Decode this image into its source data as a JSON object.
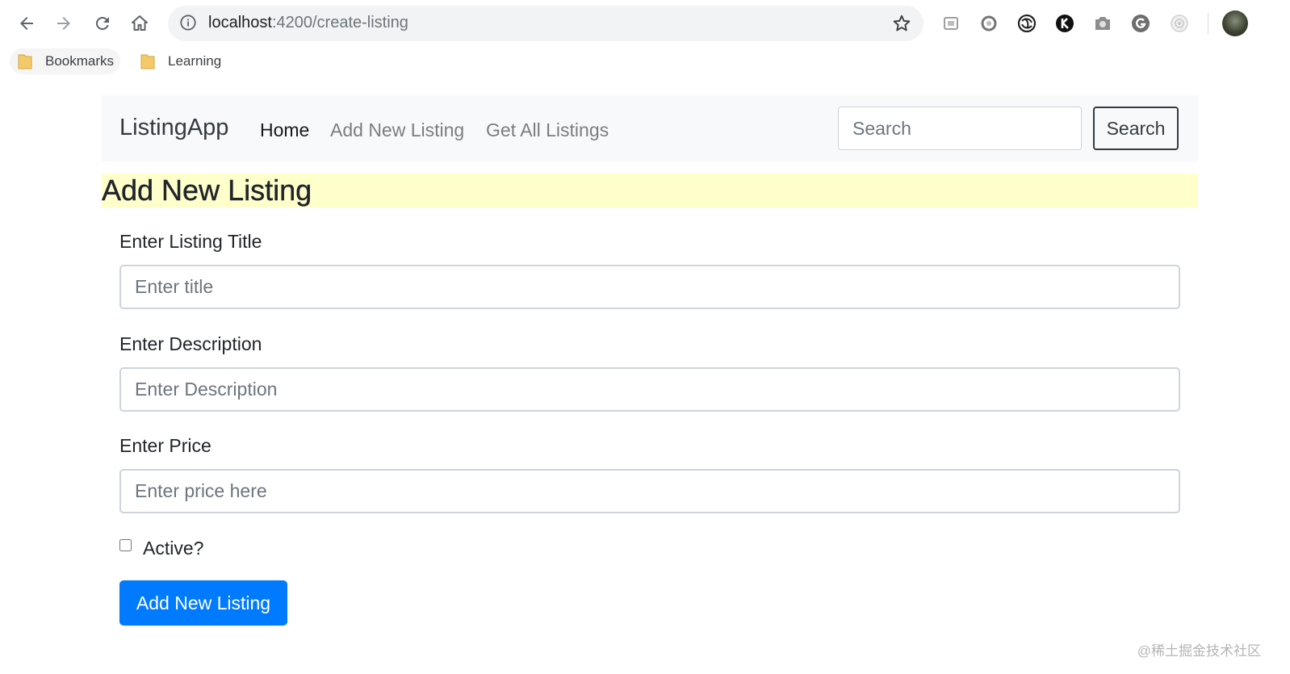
{
  "browser": {
    "url_host": "localhost",
    "url_path": ":4200/create-listing",
    "bookmarks": [
      {
        "label": "Bookmarks",
        "icon": "folder-icon"
      },
      {
        "label": "Learning",
        "icon": "folder-icon"
      }
    ],
    "extension_icons": [
      "extension-1-icon",
      "extension-2-icon",
      "extension-3-icon",
      "extension-4-icon",
      "camera-icon",
      "grammarly-icon",
      "extension-7-icon"
    ]
  },
  "navbar": {
    "brand": "ListingApp",
    "links": [
      "Home",
      "Add New Listing",
      "Get All Listings"
    ],
    "active_link": "Home",
    "search_placeholder": "Search",
    "search_button": "Search"
  },
  "page": {
    "heading": "Add New Listing",
    "heading_background": "#ffffcc",
    "form": {
      "title_label": "Enter Listing Title",
      "title_placeholder": "Enter title",
      "description_label": "Enter Description",
      "description_placeholder": "Enter Description",
      "price_label": "Enter Price",
      "price_placeholder": "Enter price here",
      "active_label": "Active?",
      "active_checked": false,
      "submit_label": "Add New Listing"
    }
  },
  "colors": {
    "primary": "#007bff",
    "navbar_bg": "#f8f9fa",
    "heading_highlight": "#ffffcc"
  },
  "watermark": "@稀土掘金技术社区"
}
